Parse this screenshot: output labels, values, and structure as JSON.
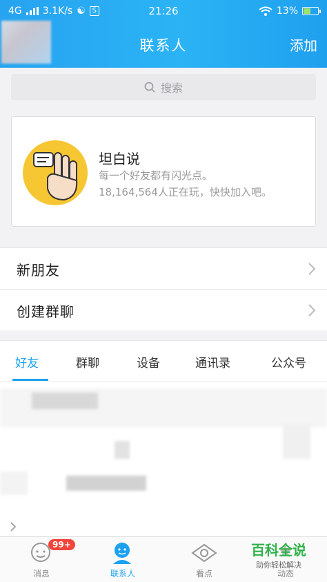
{
  "status_bar": {
    "network": "4G",
    "speed": "3.1K/s",
    "time": "21:26",
    "battery": "13%"
  },
  "header": {
    "title": "联系人",
    "add_label": "添加"
  },
  "search": {
    "placeholder": "搜索"
  },
  "promo_card": {
    "title": "坦白说",
    "subtitle": "每一个好友都有闪光点。",
    "stats": "18,164,564人正在玩，快快加入吧。",
    "icon_color": "#f7c633"
  },
  "entries": [
    {
      "label": "新朋友"
    },
    {
      "label": "创建群聊"
    }
  ],
  "tabs": [
    {
      "label": "好友",
      "active": true
    },
    {
      "label": "群聊"
    },
    {
      "label": "设备"
    },
    {
      "label": "通讯录"
    },
    {
      "label": "公众号"
    }
  ],
  "bottom_nav": [
    {
      "label": "消息",
      "icon": "chat-bubble-icon",
      "badge": "99+"
    },
    {
      "label": "联系人",
      "icon": "contacts-icon",
      "active": true
    },
    {
      "label": "看点",
      "icon": "eye-icon"
    },
    {
      "label": "动态",
      "icon": "star-icon"
    }
  ],
  "watermark": {
    "line1": "百科全说",
    "line2": "助你轻松解决"
  },
  "colors": {
    "accent": "#1aa1f0",
    "header_start": "#27a3f0",
    "badge": "#f2443a",
    "watermark": "#2fb24a"
  }
}
